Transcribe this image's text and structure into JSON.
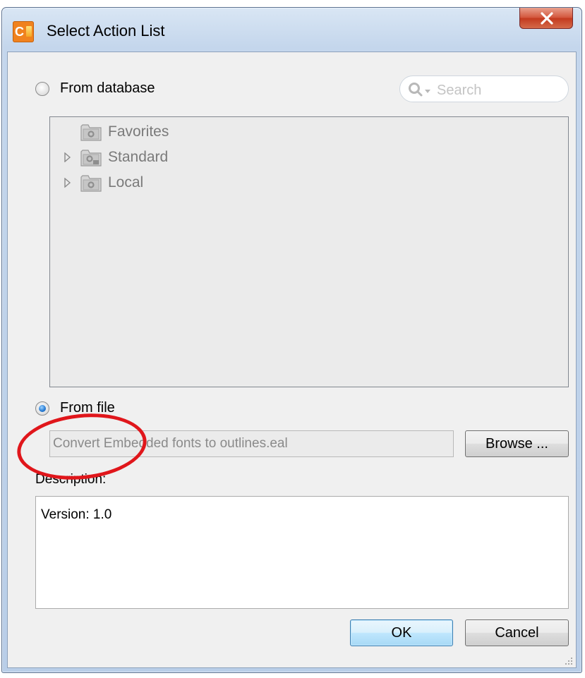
{
  "window": {
    "title": "Select Action List",
    "app_icon": "callas-pdftoolbox-icon",
    "close_icon": "close-icon"
  },
  "source": {
    "from_database_label": "From database",
    "from_database_selected": false,
    "search_placeholder": "Search",
    "tree": [
      {
        "label": "Favorites",
        "expandable": false,
        "icon": "folder-gear-icon"
      },
      {
        "label": "Standard",
        "expandable": true,
        "icon": "folder-gear-lock-icon"
      },
      {
        "label": "Local",
        "expandable": true,
        "icon": "folder-gear-icon"
      }
    ],
    "from_file_label": "From file",
    "from_file_selected": true,
    "file_path": "Convert Embedded fonts to outlines.eal",
    "browse_label": "Browse ..."
  },
  "description": {
    "label": "Description:",
    "text": "Version: 1.0"
  },
  "buttons": {
    "ok_label": "OK",
    "cancel_label": "Cancel"
  },
  "colors": {
    "highlight_circle": "#e0161b",
    "radio_selected": "#2c7fd6",
    "close_button": "#c33a1f"
  }
}
